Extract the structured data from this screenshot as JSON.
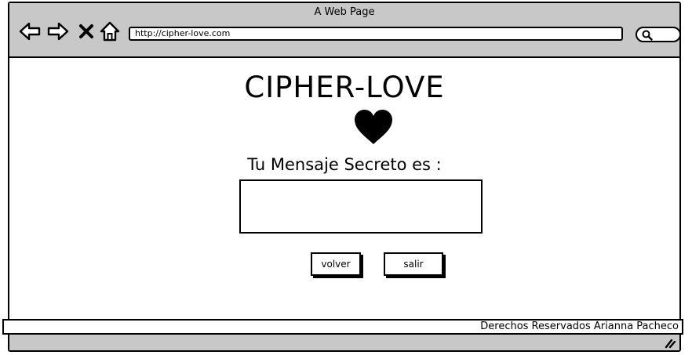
{
  "window": {
    "title": "A Web Page"
  },
  "toolbar": {
    "url": "http://cipher-love.com",
    "icons": [
      "back-arrow-icon",
      "forward-arrow-icon",
      "close-icon",
      "home-icon",
      "search-icon"
    ]
  },
  "page": {
    "title": "CIPHER-LOVE",
    "heart_icon": "heart-icon",
    "message_label": "Tu Mensaje Secreto es :",
    "message_value": "",
    "buttons": {
      "back_label": "volver",
      "exit_label": "salir"
    },
    "footer_text": "Derechos Reservados Arianna Pacheco"
  },
  "colors": {
    "chrome": "#c8c8c8",
    "background": "#ffffff",
    "ink": "#000000"
  }
}
